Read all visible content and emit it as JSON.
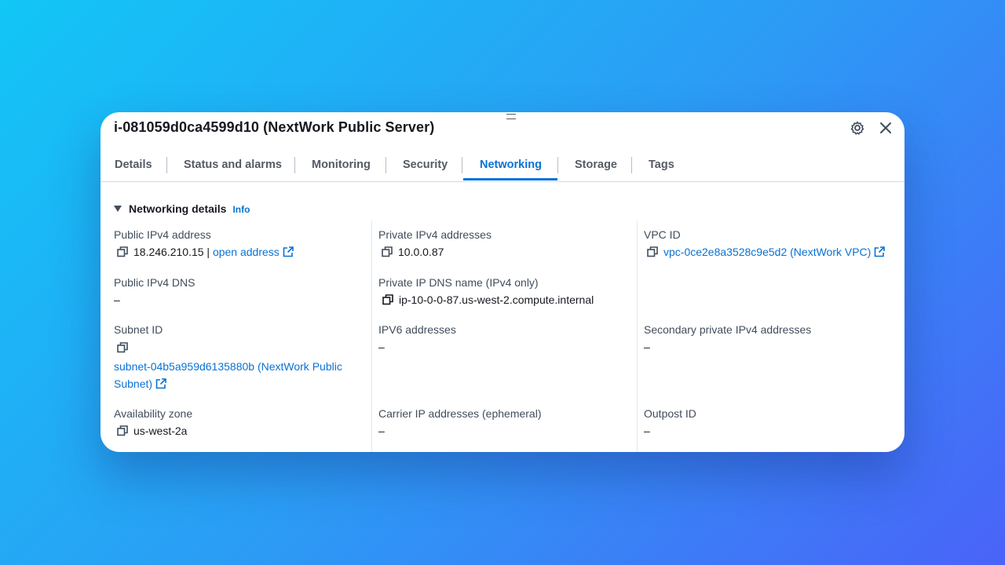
{
  "header": {
    "title": "i-081059d0ca4599d10 (NextWork Public Server)",
    "settings_icon": "gear-icon",
    "close_icon": "close-icon"
  },
  "tabs": [
    {
      "label": "Details",
      "active": false
    },
    {
      "label": "Status and alarms",
      "active": false
    },
    {
      "label": "Monitoring",
      "active": false
    },
    {
      "label": "Security",
      "active": false
    },
    {
      "label": "Networking",
      "active": true
    },
    {
      "label": "Storage",
      "active": false
    },
    {
      "label": "Tags",
      "active": false
    }
  ],
  "section": {
    "title": "Networking details",
    "info_label": "Info"
  },
  "fields": {
    "public_ipv4": {
      "label": "Public IPv4 address",
      "value": "18.246.210.15",
      "separator": "|",
      "link": "open address"
    },
    "private_ipv4": {
      "label": "Private IPv4 addresses",
      "value": "10.0.0.87"
    },
    "vpc_id": {
      "label": "VPC ID",
      "value": "vpc-0ce2e8a3528c9e5d2 (NextWork VPC)"
    },
    "public_dns": {
      "label": "Public IPv4 DNS",
      "value": "–"
    },
    "private_dns": {
      "label": "Private IP DNS name (IPv4 only)",
      "value": "ip-10-0-0-87.us-west-2.compute.internal"
    },
    "subnet_id": {
      "label": "Subnet ID",
      "value_line1": "subnet-04b5a959d6135880b (NextWork Public",
      "value_line2": "Subnet)"
    },
    "ipv6": {
      "label": "IPV6 addresses",
      "value": "–"
    },
    "secondary_private": {
      "label": "Secondary private IPv4 addresses",
      "value": "–"
    },
    "availability_zone": {
      "label": "Availability zone",
      "value": "us-west-2a"
    },
    "carrier_ip": {
      "label": "Carrier IP addresses (ephemeral)",
      "value": "–"
    },
    "outpost_id": {
      "label": "Outpost ID",
      "value": "–"
    }
  },
  "colors": {
    "accent": "#0972d3",
    "text": "#16191f",
    "label": "#414d5c"
  }
}
